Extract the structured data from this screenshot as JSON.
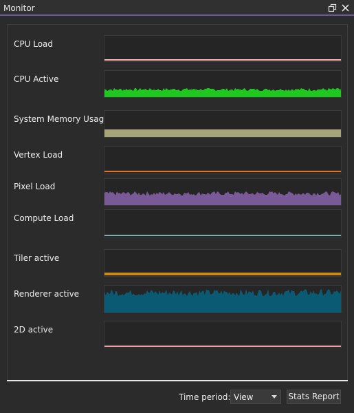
{
  "window": {
    "title": "Monitor",
    "icons": [
      "restore-icon",
      "close-icon"
    ]
  },
  "metrics": [
    {
      "label": "CPU Load",
      "color": "#ffb3b3",
      "style": "thin-line",
      "level": 0.04
    },
    {
      "label": "CPU Active",
      "color": "#1ec81e",
      "style": "noisy-fill",
      "level": 0.3
    },
    {
      "label": "System Memory Usage",
      "color": "#a6a478",
      "style": "solid-fill",
      "level": 0.3
    },
    {
      "label": "Vertex Load",
      "color": "#e0702a",
      "style": "thin-line",
      "level": 0.05
    },
    {
      "label": "Pixel Load",
      "color": "#7a5a96",
      "style": "noisy-fill",
      "level": 0.45
    },
    {
      "label": "Compute Load",
      "color": "#7bb1ad",
      "style": "thin-line",
      "level": 0.03
    },
    {
      "label": "Tiler active",
      "color": "#c98a18",
      "style": "thin-line",
      "level": 0.1
    },
    {
      "label": "Renderer active",
      "color": "#0a5a73",
      "style": "noisy-fill",
      "level": 0.75
    },
    {
      "label": "2D active",
      "color": "#f2a0a8",
      "style": "thin-line",
      "level": 0.03
    }
  ],
  "footer": {
    "time_period_label": "Time period:",
    "time_period_value": "View",
    "stats_button_label": "Stats Report"
  }
}
